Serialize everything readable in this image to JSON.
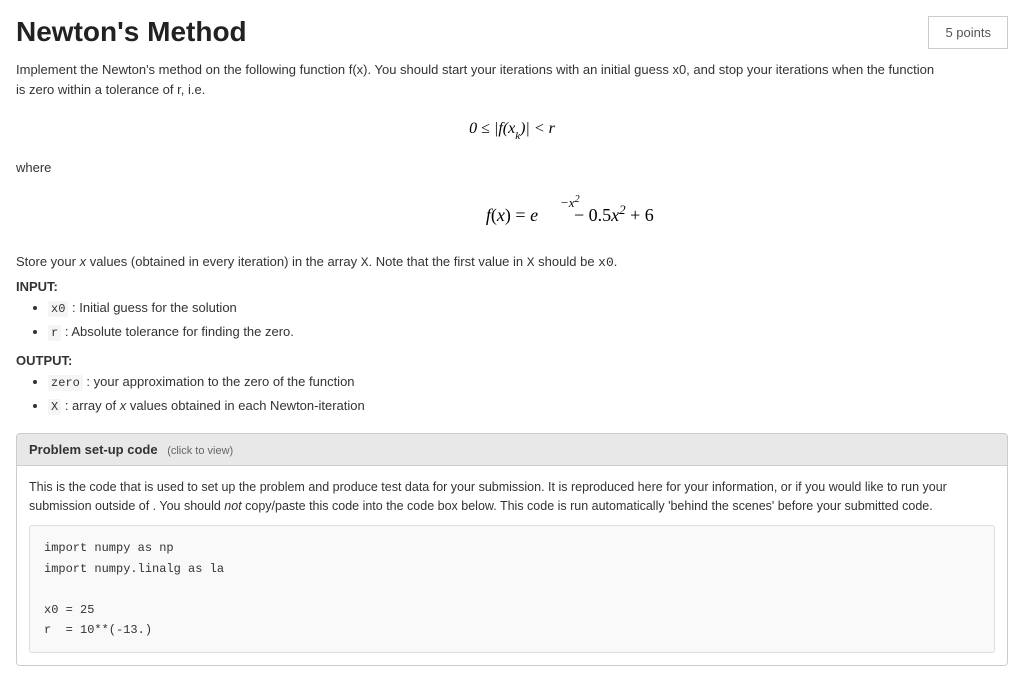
{
  "title": "Newton's Method",
  "points": "5 points",
  "description": "Implement the Newton's method on the following function f(x). You should start your iterations with an initial guess x0, and stop your iterations when the function is zero within a tolerance of r, i.e.",
  "formula_tolerance": "0 ≤ |f(xₖ)| < r",
  "where_label": "where",
  "formula_function": "f(x) = e^(−x²) − 0.5x² + 6",
  "store_text": "Store your x values (obtained in every iteration) in the array X. Note that the first value in X should be x0.",
  "input_label": "INPUT:",
  "input_items": [
    {
      "var": "x0",
      "desc": "Initial guess for the solution"
    },
    {
      "var": "r",
      "desc": "Absolute tolerance for finding the zero."
    }
  ],
  "output_label": "OUTPUT:",
  "output_items": [
    {
      "var": "zero",
      "desc": "your approximation to the zero of the function"
    },
    {
      "var": "X",
      "desc": "array of x values obtained in each Newton-iteration"
    }
  ],
  "setup_header": "Problem set-up code",
  "setup_click_text": "(click to view)",
  "setup_description": "This is the code that is used to set up the problem and produce test data for your submission. It is reproduced here for your information, or if you would like to run your submission outside of . You should not copy/paste this code into the code box below. This code is run automatically 'behind the scenes' before your submitted code.",
  "setup_code": "import numpy as np\nimport numpy.linalg as la\n\nx0 = 25\nr  = 10**(-13.)"
}
